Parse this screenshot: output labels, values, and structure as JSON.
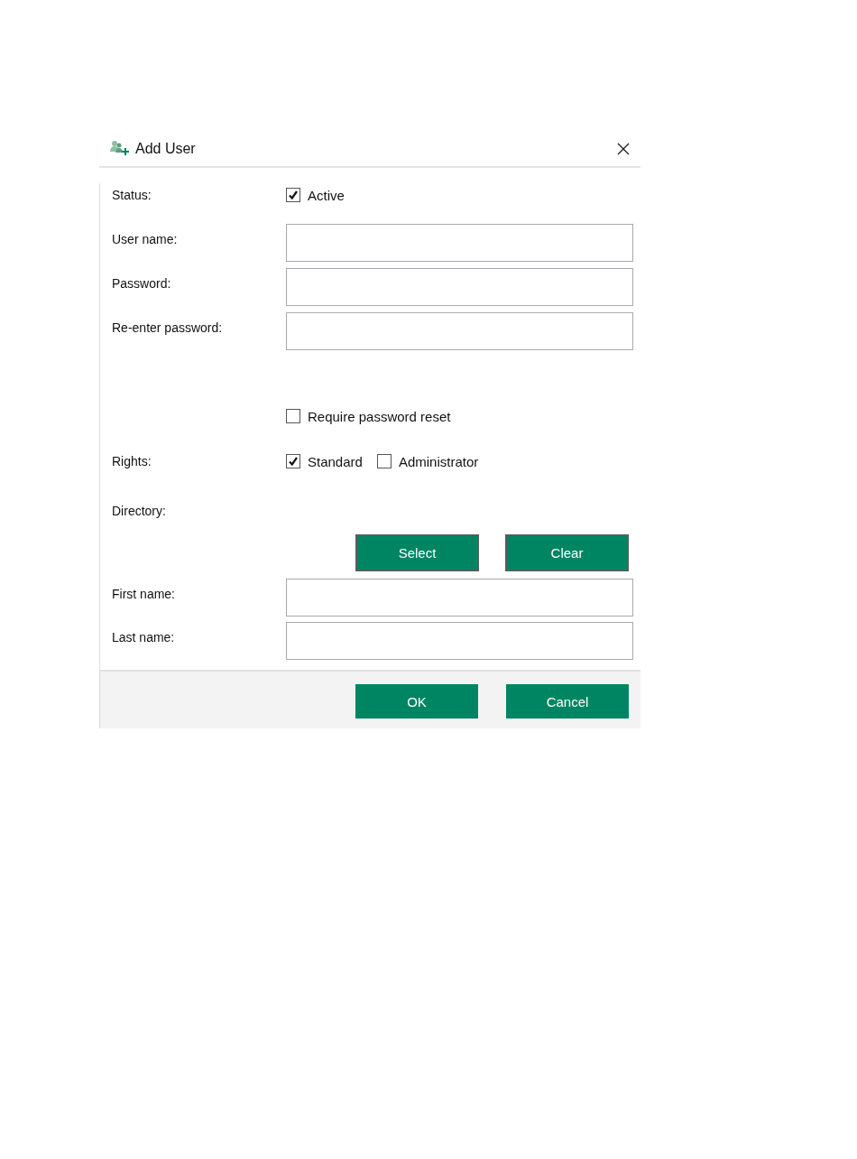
{
  "window": {
    "title": "Add User"
  },
  "rows": [
    {
      "kind": "checks",
      "label": "Status:",
      "options": [
        {
          "label": "Active",
          "checked": true
        }
      ]
    },
    {
      "kind": "field",
      "label": "User name:"
    },
    {
      "kind": "field",
      "label": "Password:"
    },
    {
      "kind": "field",
      "label": "Re-enter password:"
    },
    {
      "kind": "checks",
      "options": [
        {
          "label": "Require password reset",
          "checked": false
        }
      ]
    },
    {
      "kind": "checks",
      "label": "Rights:",
      "options": [
        {
          "label": "Standard",
          "checked": true
        },
        {
          "label": "Administrator",
          "checked": false
        }
      ]
    },
    {
      "kind": "label",
      "label": "Directory:"
    },
    {
      "kind": "buttons",
      "buttons": [
        "Select",
        "Clear"
      ]
    },
    {
      "kind": "field",
      "label": "First name:"
    },
    {
      "kind": "field",
      "label": "Last name:"
    }
  ],
  "footer": {
    "buttons": [
      "OK",
      "Cancel"
    ]
  }
}
